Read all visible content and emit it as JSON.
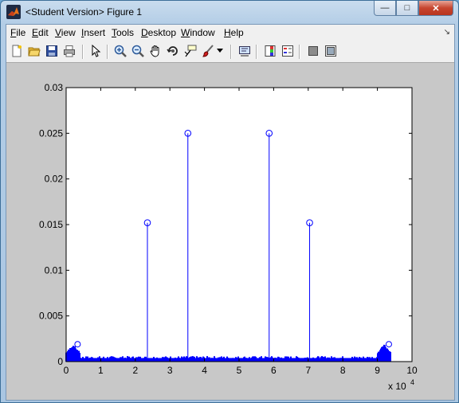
{
  "window": {
    "title": "<Student Version> Figure 1",
    "buttons": {
      "minimize": "—",
      "maximize": "□",
      "close": "✕"
    }
  },
  "menu": [
    {
      "label": "File",
      "accel": "F",
      "rest": "ile"
    },
    {
      "label": "Edit",
      "accel": "E",
      "rest": "dit"
    },
    {
      "label": "View",
      "accel": "V",
      "rest": "iew"
    },
    {
      "label": "Insert",
      "accel": "I",
      "rest": "nsert"
    },
    {
      "label": "Tools",
      "accel": "T",
      "rest": "ools"
    },
    {
      "label": "Desktop",
      "accel": "D",
      "rest": "esktop"
    },
    {
      "label": "Window",
      "accel": "W",
      "rest": "indow"
    },
    {
      "label": "Help",
      "accel": "H",
      "rest": "elp"
    }
  ],
  "toolbar": [
    "new-figure-icon",
    "open-file-icon",
    "save-icon",
    "print-icon",
    "edit-plot-arrow-icon",
    "zoom-in-icon",
    "zoom-out-icon",
    "pan-hand-icon",
    "rotate-3d-icon",
    "data-cursor-icon",
    "brush-icon",
    "brush-dropdown-icon",
    "link-plot-icon",
    "colorbar-icon",
    "legend-icon",
    "hide-plot-tools-icon",
    "show-plot-tools-icon"
  ],
  "chart_data": {
    "type": "stem",
    "xlim": [
      0,
      10
    ],
    "ylim": [
      0,
      0.03
    ],
    "x_exponent_label": "x 10",
    "x_exponent_power": "4",
    "xticks": [
      "0",
      "1",
      "2",
      "3",
      "4",
      "5",
      "6",
      "7",
      "8",
      "9",
      "10"
    ],
    "yticks": [
      "0",
      "0.005",
      "0.01",
      "0.015",
      "0.02",
      "0.025",
      "0.03"
    ],
    "ytick_values": [
      0,
      0.005,
      0.01,
      0.015,
      0.02,
      0.025,
      0.03
    ],
    "grid": false,
    "color": "#0000ff",
    "marker": "circle",
    "stems": [
      {
        "x": 2.35,
        "y": 0.0152
      },
      {
        "x": 3.52,
        "y": 0.025
      },
      {
        "x": 5.87,
        "y": 0.025
      },
      {
        "x": 7.04,
        "y": 0.0152
      }
    ],
    "noise_floor": {
      "x_range": [
        0,
        9.4
      ],
      "typical_y": 0.0004,
      "edge_bumps": [
        {
          "x_range": [
            0,
            0.4
          ],
          "peak_y": 0.0019
        },
        {
          "x_range": [
            9.0,
            9.4
          ],
          "peak_y": 0.0019
        }
      ]
    }
  }
}
